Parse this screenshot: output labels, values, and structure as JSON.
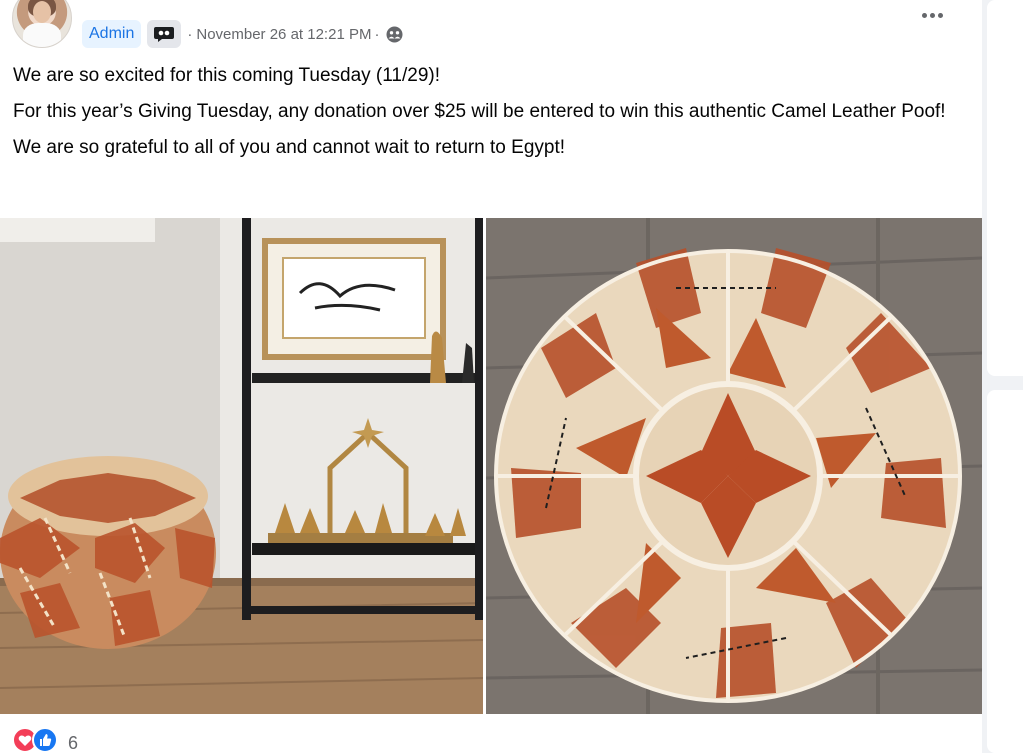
{
  "post": {
    "author_badge": "Admin",
    "separator": "·",
    "timestamp": "November 26 at 12:21 PM",
    "paragraphs": [
      "We are so excited for this coming Tuesday (11/29)!",
      "For this year’s Giving Tuesday, any donation over $25 will be entered to win this authentic Camel Leather Poof!",
      "We are so grateful to all of you and cannot wait to return to Egypt!"
    ],
    "reaction_count": "6"
  },
  "icons": {
    "more": "more-options-icon",
    "badge": "chat-badge-icon",
    "privacy": "group-members-icon",
    "reactions": [
      "love-reaction-icon",
      "like-reaction-icon"
    ]
  },
  "colors": {
    "accent": "#1b74e4",
    "badge_bg": "#e7f3ff",
    "secondary_text": "#65676b",
    "love": "#f33e58",
    "like": "#1877f2"
  }
}
